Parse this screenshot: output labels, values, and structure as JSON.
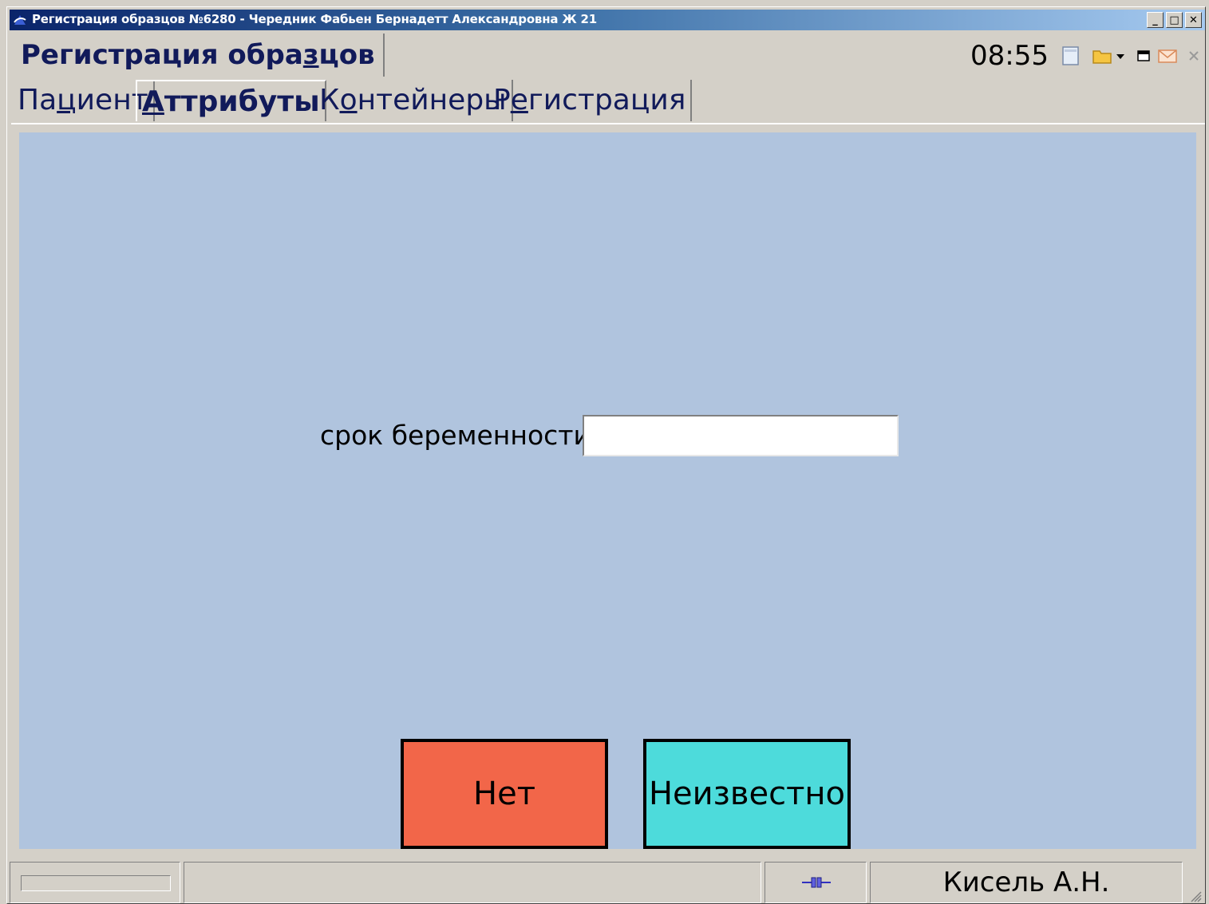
{
  "window": {
    "title": "Регистрация образцов №6280 - Чередник Фабьен Бернадетт Александровна Ж 21",
    "minimize_label": "_",
    "maximize_label": "□",
    "close_label": "✕"
  },
  "header": {
    "title_pre": "Регистрация обра",
    "title_mnemonic": "з",
    "title_post": "цов",
    "clock": "08:55",
    "icons": [
      "notes-icon",
      "folder-icon",
      "chevron-down-icon",
      "window-icon",
      "mail-icon",
      "close-icon"
    ]
  },
  "tabs": [
    {
      "pre": "Па",
      "mnemonic": "ц",
      "post": "иент",
      "active": false
    },
    {
      "pre": "",
      "mnemonic": "А",
      "post": "ттрибуты",
      "active": true
    },
    {
      "pre": "К",
      "mnemonic": "о",
      "post": "нтейнеры",
      "active": false
    },
    {
      "pre": "Р",
      "mnemonic": "е",
      "post": "гистрация",
      "active": false
    }
  ],
  "form": {
    "field_label": "срок беременности",
    "field_value": "",
    "btn_no_label": "Нет",
    "btn_unknown_label": "Неизвестно",
    "btn_no_color": "#f26649",
    "btn_unknown_color": "#4ddbdb",
    "background_color": "#b0c4de"
  },
  "statusbar": {
    "user": "Кисель А.Н."
  }
}
